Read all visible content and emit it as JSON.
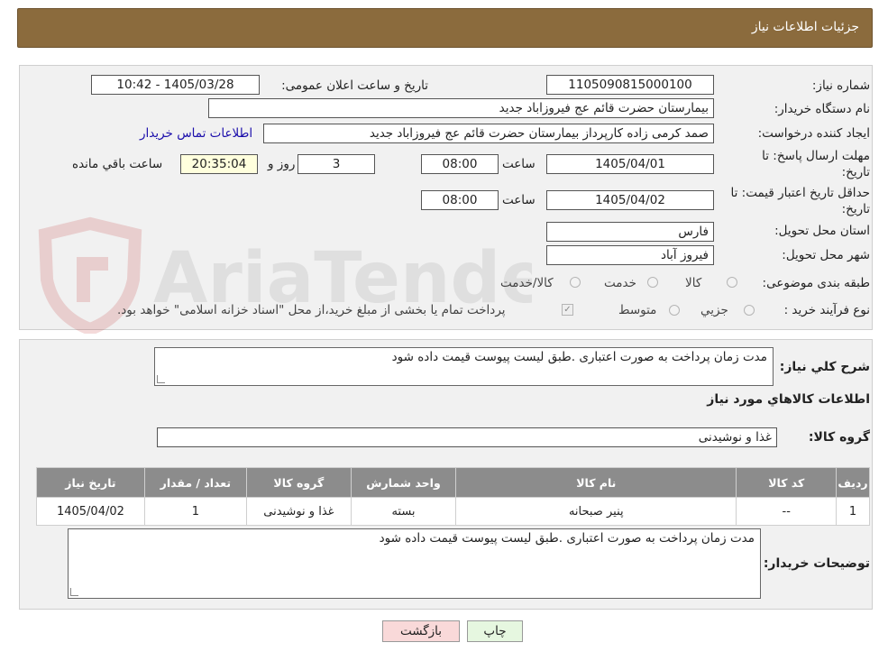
{
  "header": {
    "title": "جزئیات اطلاعات نیاز"
  },
  "watermark": {
    "text": "AriaTender.neT"
  },
  "form": {
    "need_number": {
      "label": "شماره نیاز:",
      "value": "1105090815000100"
    },
    "announce_datetime": {
      "label": "تاریخ و ساعت اعلان عمومی:",
      "value": "1405/03/28 - 10:42"
    },
    "buyer_org": {
      "label": "نام دستگاه خریدار:",
      "value": "بیمارستان حضرت قائم  عج  فیروزاباد جدید"
    },
    "requester": {
      "label": "ایجاد کننده درخواست:",
      "value": "صمد کرمی زاده کارپرداز بیمارستان حضرت قائم  عج  فیروزاباد جدید"
    },
    "contact_link": "اطلاعات تماس خریدار",
    "reply_deadline": {
      "label_line1": "مهلت ارسال پاسخ: تا",
      "label_line2": "تاریخ:",
      "date": "1405/04/01",
      "time_label": "ساعت",
      "time": "08:00",
      "days": "3",
      "days_label": "روز و",
      "remaining": "20:35:04",
      "remaining_label": "ساعت باقي مانده"
    },
    "price_validity": {
      "label_line1": "حداقل تاریخ اعتبار قیمت: تا",
      "label_line2": "تاریخ:",
      "date": "1405/04/02",
      "time_label": "ساعت",
      "time": "08:00"
    },
    "province": {
      "label": "استان محل تحویل:",
      "value": "فارس"
    },
    "city": {
      "label": "شهر محل تحویل:",
      "value": "فیروز آباد"
    },
    "category": {
      "label": "طبقه بندی موضوعی:",
      "options": [
        "کالا",
        "خدمت",
        "کالا/خدمت"
      ]
    },
    "process_type": {
      "label": "نوع فرآیند خرید :",
      "options": [
        "جزیي",
        "متوسط"
      ],
      "payment_note": "پرداخت تمام یا بخشی از مبلغ خرید،از محل \"اسناد خزانه اسلامی\" خواهد بود."
    }
  },
  "summary": {
    "label": "شرح کلي نياز:",
    "value": "مدت زمان پرداخت به صورت اعتباری .طبق لیست پیوست قیمت داده شود"
  },
  "goods": {
    "section_title": "اطلاعات کالاهاي مورد نياز",
    "group_label": "گروه کالا:",
    "group_value": "غذا و نوشیدنی",
    "table": {
      "columns": [
        "ردیف",
        "کد کالا",
        "نام کالا",
        "واحد شمارش",
        "گروه کالا",
        "تعداد / مقدار",
        "تاریخ نیاز"
      ],
      "rows": [
        [
          "1",
          "--",
          "پنیر صبحانه",
          "بسته",
          "غذا و نوشیدنی",
          "1",
          "1405/04/02"
        ]
      ]
    }
  },
  "buyer_notes": {
    "label": "توضیحات خریدار:",
    "value": "مدت زمان پرداخت به صورت اعتباری .طبق لیست پیوست قیمت داده شود"
  },
  "buttons": {
    "print": "چاپ",
    "back": "بازگشت"
  }
}
